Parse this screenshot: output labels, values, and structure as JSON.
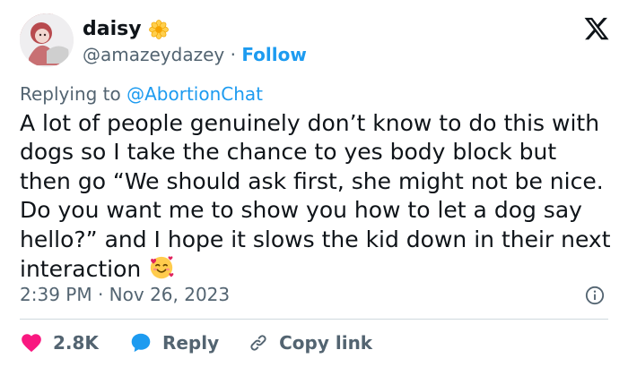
{
  "author": {
    "name": "daisy",
    "handle": "@amazeydazey",
    "separator": "·",
    "follow_label": "Follow",
    "avatar_icon": "user-avatar-photo",
    "badge_icon": "flower-icon"
  },
  "brand_icon": "x-logo-icon",
  "reply_prefix": "Replying to",
  "reply_to": "@AbortionChat",
  "tweet": {
    "text": "A lot of people genuinely don’t know to do this with dogs so I take the chance to yes body block but then go “We should ask first, she might not be nice. Do you want me to show you how to let a dog say hello?” and I hope it slows the kid down in their next interaction",
    "emoji_icon": "smiling-face-with-hearts-icon"
  },
  "meta": {
    "time": "2:39 PM",
    "date": "Nov 26, 2023",
    "separator": "·",
    "info_icon": "info-icon"
  },
  "actions": {
    "likes": "2.8K",
    "reply_label": "Reply",
    "copy_label": "Copy link",
    "like_icon": "heart-icon",
    "reply_icon": "reply-bubble-icon",
    "copy_icon": "link-icon"
  },
  "colors": {
    "accent": "#1d9bf0",
    "text": "#0f1419",
    "secondary": "#536471",
    "heart": "#f91880",
    "divider": "#cfd9de"
  }
}
